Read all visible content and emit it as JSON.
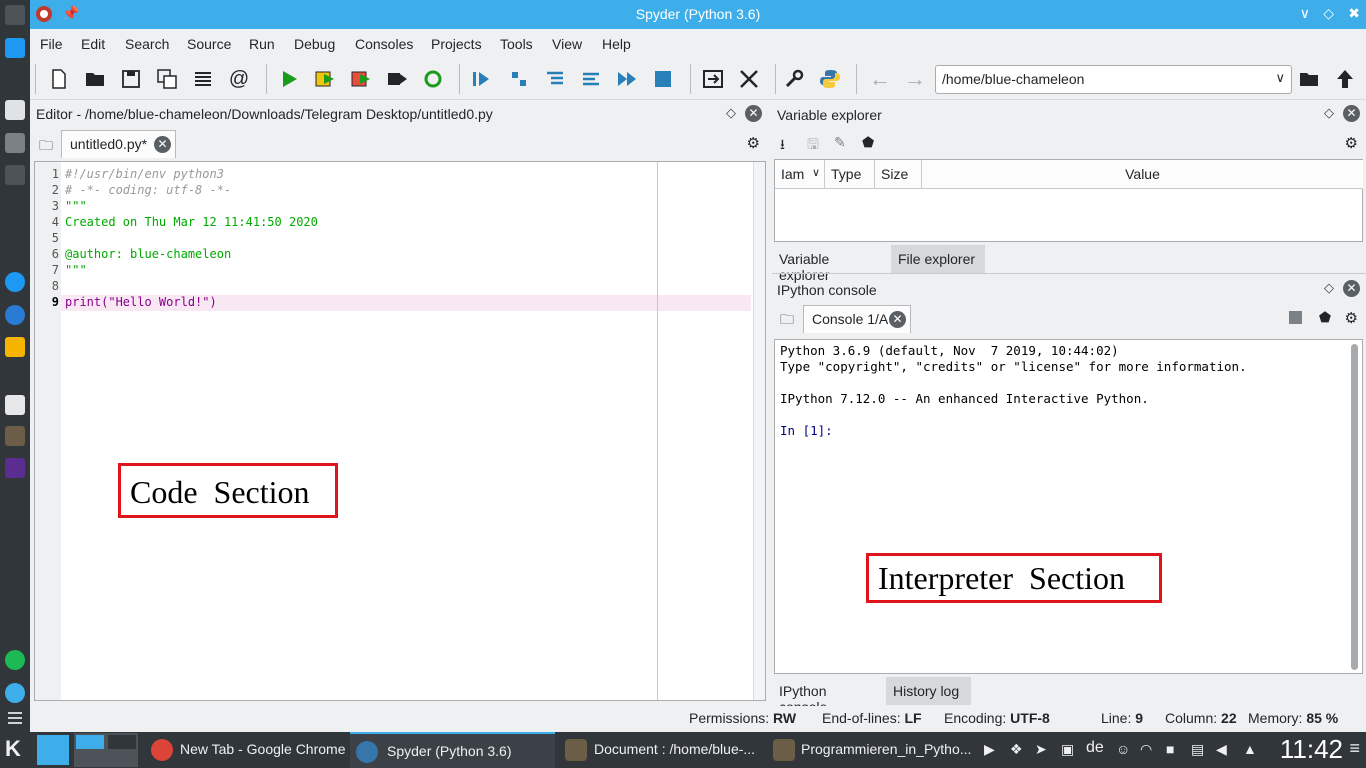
{
  "window": {
    "title": "Spyder (Python 3.6)"
  },
  "menu": [
    "File",
    "Edit",
    "Search",
    "Source",
    "Run",
    "Debug",
    "Consoles",
    "Projects",
    "Tools",
    "View",
    "Help"
  ],
  "toolbar": {
    "working_dir": "/home/blue-chameleon"
  },
  "editor": {
    "title": "Editor - /home/blue-chameleon/Downloads/Telegram Desktop/untitled0.py",
    "tab_label": "untitled0.py*",
    "line_numbers": [
      "1",
      "2",
      "3",
      "4",
      "5",
      "6",
      "7",
      "8",
      "9"
    ],
    "code_lines": [
      "#!/usr/bin/env python3",
      "# -*- coding: utf-8 -*-",
      "\"\"\"",
      "Created on Thu Mar 12 11:41:50 2020",
      "",
      "@author: blue-chameleon",
      "\"\"\"",
      "",
      "print(\"Hello World!\")"
    ]
  },
  "annotations": {
    "code": "Code  Section",
    "interpreter": "Interpreter  Section"
  },
  "variable_explorer": {
    "title": "Variable explorer",
    "columns": [
      "Iam",
      "Type",
      "Size",
      "Value"
    ],
    "tabs": [
      "Variable explorer",
      "File explorer"
    ]
  },
  "console": {
    "title": "IPython console",
    "tab_label": "Console 1/A",
    "lines": [
      "Python 3.6.9 (default, Nov  7 2019, 10:44:02)",
      "Type \"copyright\", \"credits\" or \"license\" for more information.",
      "",
      "IPython 7.12.0 -- An enhanced Interactive Python.",
      "",
      "In [1]:"
    ],
    "tabs": [
      "IPython console",
      "History log"
    ]
  },
  "statusbar": {
    "permissions_label": "Permissions:",
    "permissions_value": "RW",
    "eol_label": "End-of-lines:",
    "eol_value": "LF",
    "encoding_label": "Encoding:",
    "encoding_value": "UTF-8",
    "line_label": "Line:",
    "line_value": "9",
    "column_label": "Column:",
    "column_value": "22",
    "memory_label": "Memory:",
    "memory_value": "85 %"
  },
  "taskbar": {
    "tasks": [
      "New Tab - Google Chrome",
      "Spyder (Python 3.6)",
      "Document : /home/blue-...",
      "Programmieren_in_Pytho..."
    ],
    "keyboard_layout": "de",
    "clock": "11:42"
  }
}
